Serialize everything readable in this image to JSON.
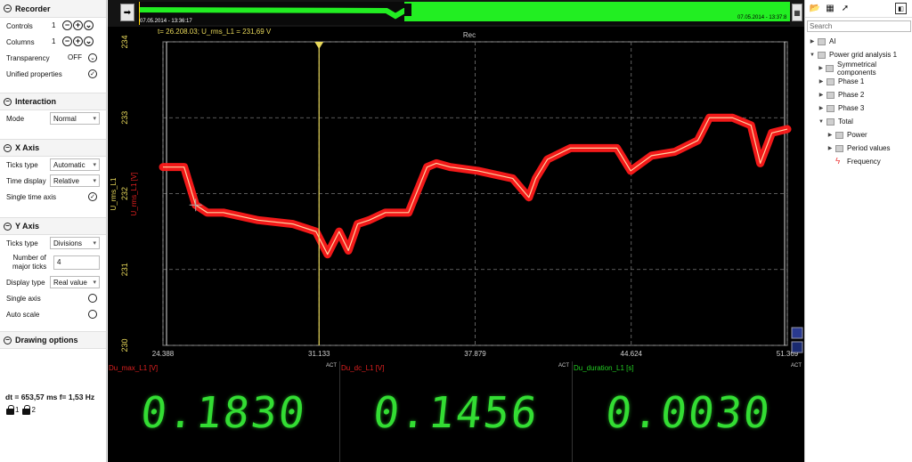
{
  "recorder": {
    "title": "Recorder",
    "controls_label": "Controls",
    "controls_value": "1",
    "columns_label": "Columns",
    "columns_value": "1",
    "transparency_label": "Transparency",
    "transparency_value": "OFF",
    "unified_label": "Unified properties"
  },
  "interaction": {
    "title": "Interaction",
    "mode_label": "Mode",
    "mode_value": "Normal"
  },
  "xaxis": {
    "title": "X Axis",
    "ticks_type_label": "Ticks type",
    "ticks_type_value": "Automatic",
    "time_display_label": "Time display",
    "time_display_value": "Relative",
    "single_time_label": "Single time axis"
  },
  "yaxis": {
    "title": "Y Axis",
    "ticks_type_label": "Ticks type",
    "ticks_type_value": "Divisions",
    "major_ticks_label1": "Number of",
    "major_ticks_label2": "major ticks",
    "major_ticks_value": "4",
    "display_type_label": "Display type",
    "display_type_value": "Real value",
    "single_axis_label": "Single axis",
    "auto_scale_label": "Auto scale"
  },
  "drawing": {
    "title": "Drawing options",
    "dt_text": "dt = 653,57 ms  f= 1,53 Hz",
    "lock1": "1",
    "lock2": "2"
  },
  "overview": {
    "start_date": "07.05.2014 - 13:36:17",
    "end_date": "07.05.2014 - 13:37:8"
  },
  "plot": {
    "cursor_readout": "t= 26.208.03;  U_rms_L1 = 231,69 V",
    "rec_label": "Rec",
    "ylabel_green": "U_rms_L1",
    "ylabel_red": "U_rms_L1 [V]"
  },
  "chart_data": {
    "type": "line",
    "x": [
      24.388,
      25.3,
      25.8,
      26.3,
      27.0,
      28.5,
      30.0,
      31.0,
      31.5,
      32.0,
      32.4,
      32.8,
      33.3,
      34.0,
      35.0,
      35.8,
      36.2,
      36.8,
      38.0,
      39.5,
      40.2,
      40.5,
      41.0,
      42.0,
      43.0,
      44.0,
      44.6,
      45.5,
      46.5,
      47.5,
      48.0,
      49.0,
      49.8,
      50.2,
      50.7,
      51.369
    ],
    "y": [
      232.35,
      232.35,
      231.85,
      231.75,
      231.75,
      231.65,
      231.6,
      231.5,
      231.2,
      231.5,
      231.25,
      231.6,
      231.65,
      231.75,
      231.75,
      232.35,
      232.4,
      232.35,
      232.3,
      232.2,
      231.95,
      232.2,
      232.45,
      232.6,
      232.6,
      232.6,
      232.3,
      232.5,
      232.55,
      232.7,
      233.0,
      233.0,
      232.9,
      232.4,
      232.8,
      232.85
    ],
    "series": [
      {
        "name": "U_rms_L1",
        "color": "#ff1a1a"
      }
    ],
    "xlim": [
      24.388,
      51.369
    ],
    "ylim": [
      230,
      234
    ],
    "x_ticks": [
      "24.388",
      "31.133",
      "37.879",
      "44.624",
      "51.369"
    ],
    "y_ticks": [
      "230",
      "231",
      "232",
      "233",
      "234"
    ],
    "grid": true,
    "cursor_x": 31.133
  },
  "meters": [
    {
      "label": "Du_max_L1 [V]",
      "act": "ACT",
      "value": "0.1830"
    },
    {
      "label": "Du_dc_L1 [V]",
      "act": "ACT",
      "value": "0.1456"
    },
    {
      "label": "Du_duration_L1 [s]",
      "act": "ACT",
      "value": "0.0030"
    }
  ],
  "tree": {
    "search_placeholder": "Search",
    "items": [
      {
        "label": "AI"
      },
      {
        "label": "Power grid analysis 1"
      },
      {
        "label": "Symmetrical components"
      },
      {
        "label": "Phase 1"
      },
      {
        "label": "Phase 2"
      },
      {
        "label": "Phase 3"
      },
      {
        "label": "Total"
      },
      {
        "label": "Power"
      },
      {
        "label": "Period values"
      },
      {
        "label": "Frequency"
      }
    ]
  },
  "colors": {
    "signal": "#ff1a1a",
    "signal_core": "#ffd0a0",
    "meter_digits": "#33dd33",
    "overview_green": "#22ee22"
  }
}
